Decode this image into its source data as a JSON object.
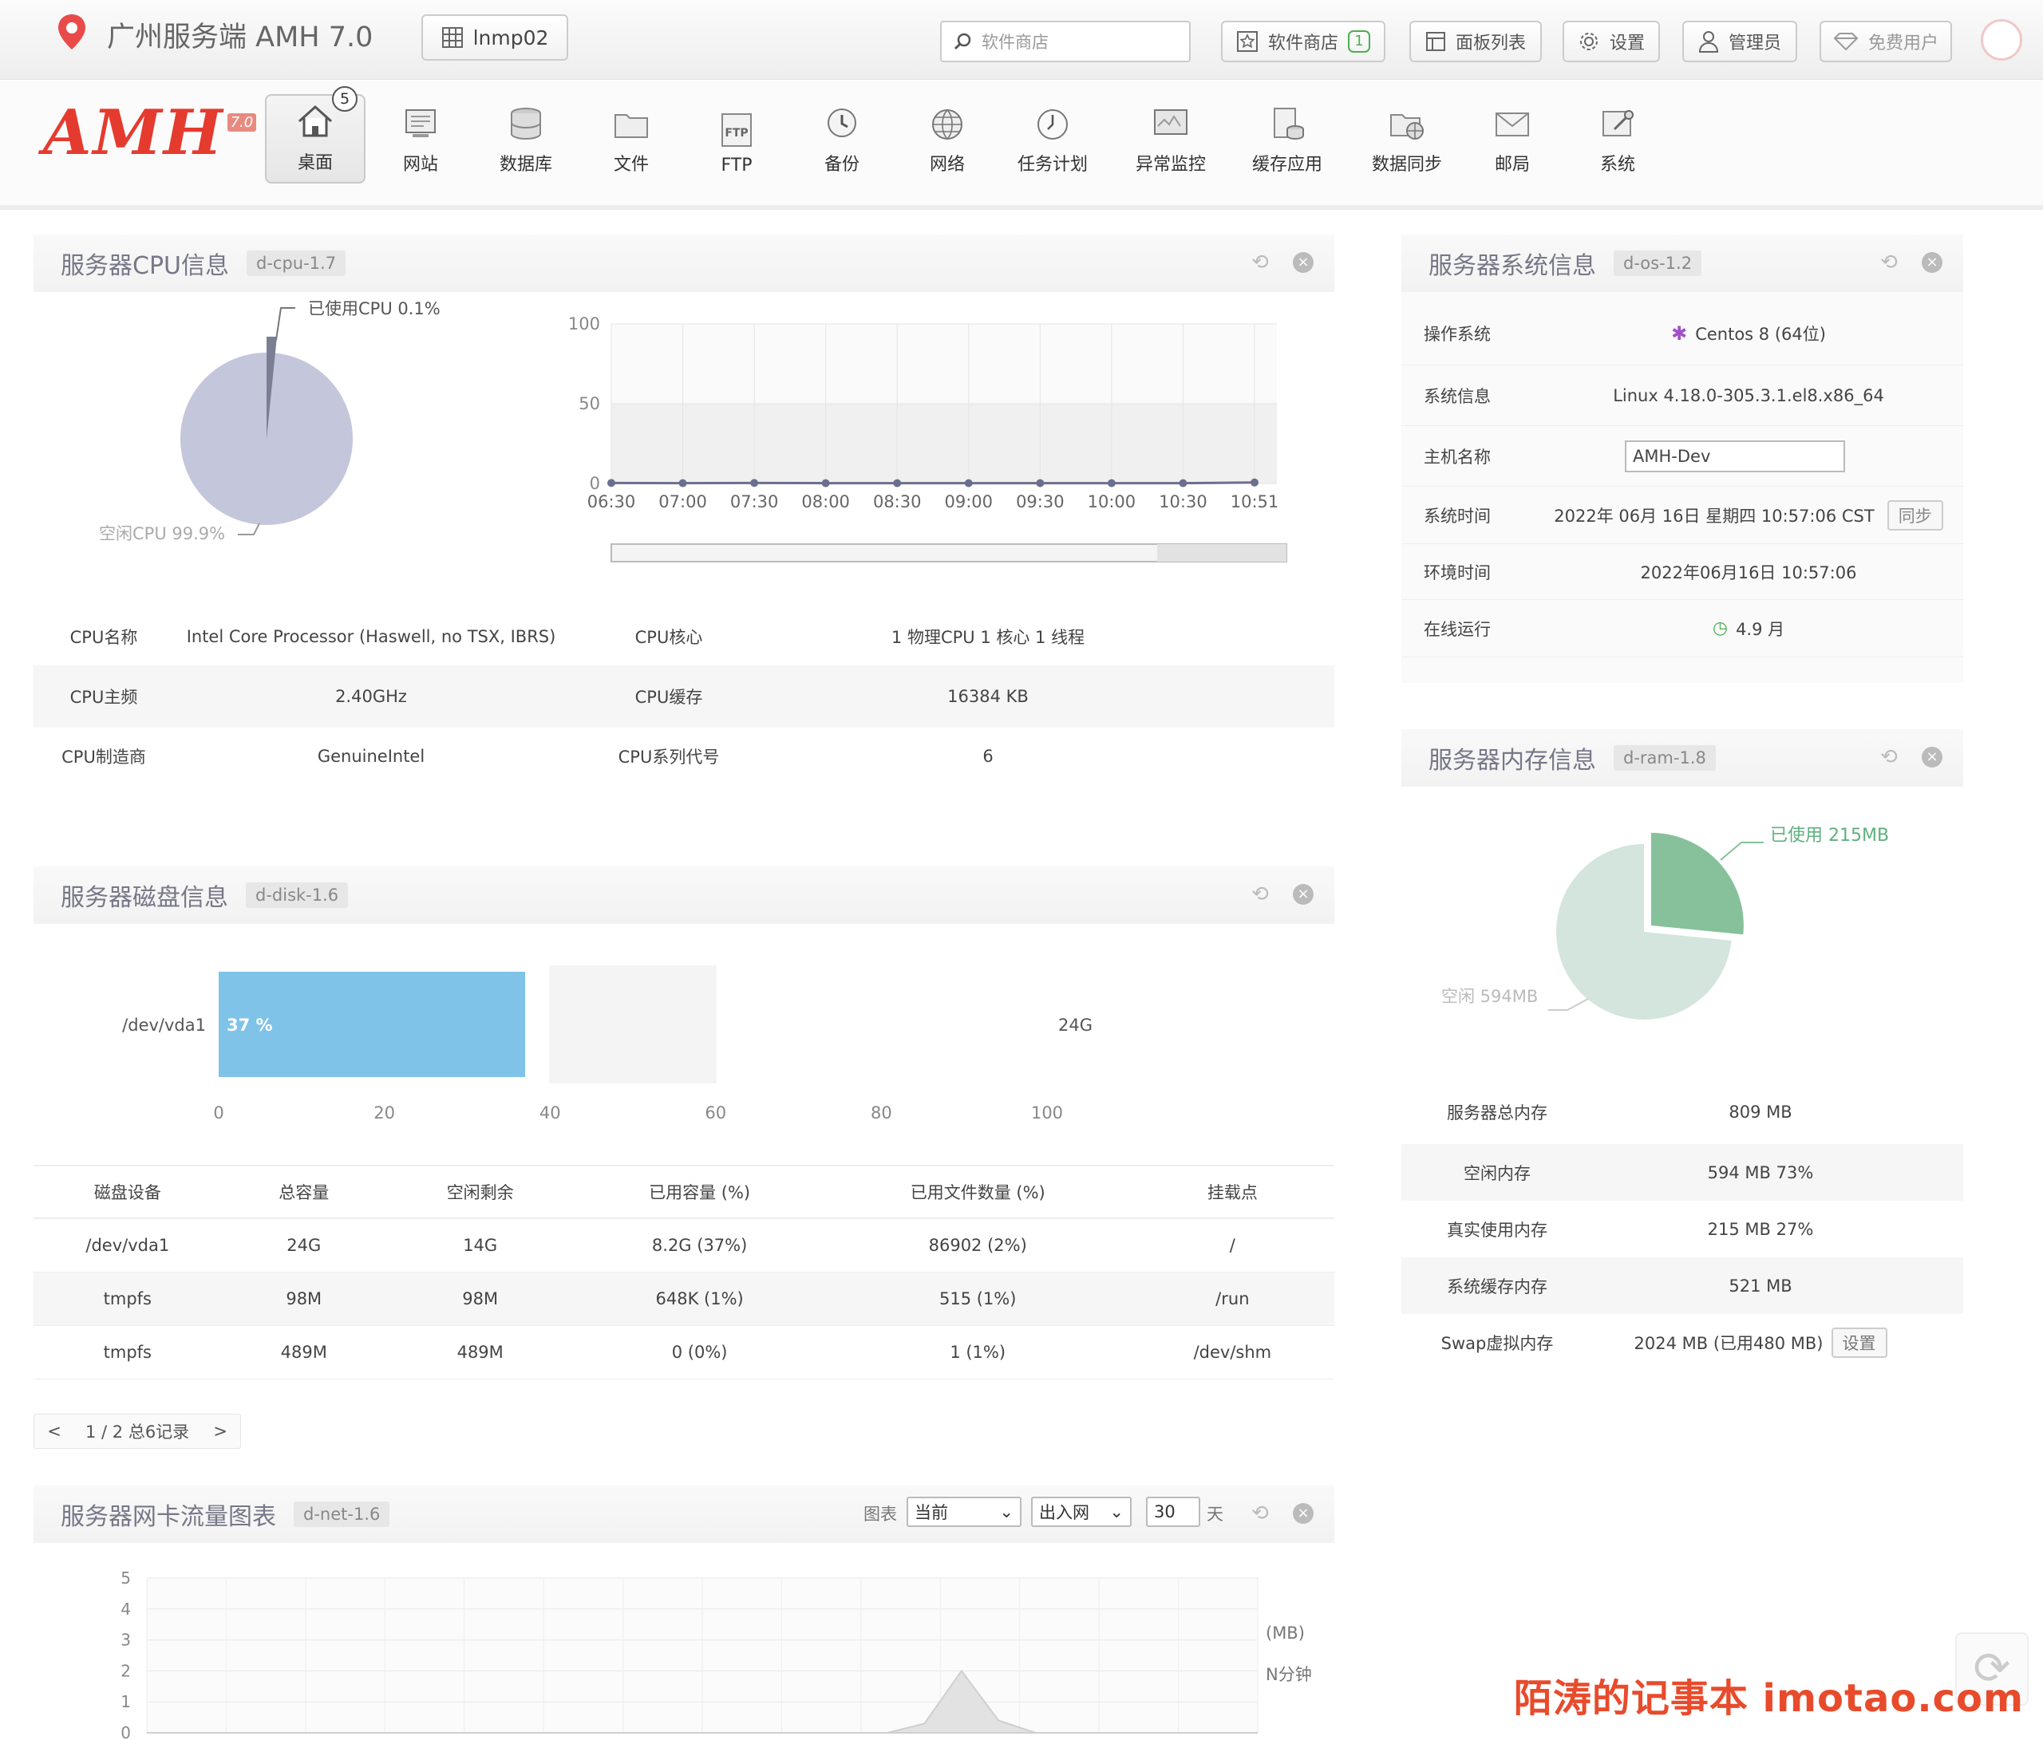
{
  "header": {
    "site_title": "广州服务端 AMH 7.0",
    "server_button": "lnmp02",
    "search_placeholder": "软件商店",
    "store_button": "软件商店",
    "store_badge": "1",
    "panel_list_button": "面板列表",
    "settings_button": "设置",
    "admin_button": "管理员",
    "free_user_button": "免费用户"
  },
  "nav": {
    "logo_text": "AMH",
    "logo_version": "7.0",
    "desktop_badge": "5",
    "items": [
      {
        "label": "桌面",
        "icon": "home-icon"
      },
      {
        "label": "网站",
        "icon": "website-icon"
      },
      {
        "label": "数据库",
        "icon": "database-icon"
      },
      {
        "label": "文件",
        "icon": "folder-icon"
      },
      {
        "label": "FTP",
        "icon": "ftp-icon"
      },
      {
        "label": "备份",
        "icon": "backup-icon"
      },
      {
        "label": "网络",
        "icon": "globe-icon"
      },
      {
        "label": "任务计划",
        "icon": "clock-icon"
      },
      {
        "label": "异常监控",
        "icon": "monitor-icon"
      },
      {
        "label": "缓存应用",
        "icon": "cache-icon"
      },
      {
        "label": "数据同步",
        "icon": "sync-icon"
      },
      {
        "label": "邮局",
        "icon": "mail-icon"
      },
      {
        "label": "系统",
        "icon": "system-icon"
      }
    ]
  },
  "cpu": {
    "title": "服务器CPU信息",
    "tag": "d-cpu-1.7",
    "pie_used_label": "已使用CPU 0.1%",
    "pie_idle_label": "空闲CPU 99.9%",
    "rows": [
      {
        "k1": "CPU名称",
        "v1": "Intel Core Processor (Haswell, no TSX, IBRS)",
        "k2": "CPU核心",
        "v2": "1 物理CPU  1 核心  1 线程"
      },
      {
        "k1": "CPU主频",
        "v1": "2.40GHz",
        "k2": "CPU缓存",
        "v2": "16384 KB"
      },
      {
        "k1": "CPU制造商",
        "v1": "GenuineIntel",
        "k2": "CPU系列代号",
        "v2": "6"
      }
    ]
  },
  "os": {
    "title": "服务器系统信息",
    "tag": "d-os-1.2",
    "rows": [
      {
        "k": "操作系统",
        "v": "Centos 8 (64位)"
      },
      {
        "k": "系统信息",
        "v": "Linux 4.18.0-305.3.1.el8.x86_64"
      },
      {
        "k": "主机名称",
        "v": "AMH-Dev"
      },
      {
        "k": "系统时间",
        "v": "2022年 06月 16日 星期四 10:57:06 CST",
        "btn": "同步"
      },
      {
        "k": "环境时间",
        "v": "2022年06月16日 10:57:06"
      },
      {
        "k": "在线运行",
        "v": "4.9 月"
      }
    ]
  },
  "ram": {
    "title": "服务器内存信息",
    "tag": "d-ram-1.8",
    "used_label": "已使用 215MB",
    "idle_label": "空闲 594MB",
    "rows": [
      {
        "k": "服务器总内存",
        "v": "809 MB"
      },
      {
        "k": "空闲内存",
        "v": "594 MB  73%"
      },
      {
        "k": "真实使用内存",
        "v": "215 MB  27%"
      },
      {
        "k": "系统缓存内存",
        "v": "521 MB"
      },
      {
        "k": "Swap虚拟内存",
        "v": "2024 MB (已用480 MB)",
        "btn": "设置"
      }
    ]
  },
  "disk": {
    "title": "服务器磁盘信息",
    "tag": "d-disk-1.6",
    "bar_device": "/dev/vda1",
    "bar_percent_label": "37 %",
    "bar_total": "24G",
    "headers": [
      "磁盘设备",
      "总容量",
      "空闲剩余",
      "已用容量 (%)",
      "已用文件数量 (%)",
      "挂载点"
    ],
    "rows": [
      [
        "/dev/vda1",
        "24G",
        "14G",
        "8.2G (37%)",
        "86902 (2%)",
        "/"
      ],
      [
        "tmpfs",
        "98M",
        "98M",
        "648K (1%)",
        "515 (1%)",
        "/run"
      ],
      [
        "tmpfs",
        "489M",
        "489M",
        "0 (0%)",
        "1 (1%)",
        "/dev/shm"
      ]
    ],
    "pager": {
      "prev": "<",
      "info": "1 / 2 总6记录",
      "next": ">"
    }
  },
  "net": {
    "title": "服务器网卡流量图表",
    "tag": "d-net-1.6",
    "chart_label": "图表",
    "select_time": "当前",
    "select_dir": "出入网",
    "days_value": "30",
    "days_unit": "天",
    "unit_label": "(MB)",
    "interval_label": "N分钟"
  },
  "watermark": "陌涛的记事本  imotao.com",
  "chart_data": [
    {
      "type": "pie",
      "title": "",
      "slices": [
        {
          "label": "已使用CPU",
          "value": 0.1
        },
        {
          "label": "空闲CPU",
          "value": 99.9
        }
      ]
    },
    {
      "type": "line",
      "x": [
        "06:30",
        "07:00",
        "07:30",
        "08:00",
        "08:30",
        "09:00",
        "09:30",
        "10:00",
        "10:30",
        "10:51"
      ],
      "series": [
        {
          "values": [
            0.3,
            0.2,
            0.3,
            0.2,
            0.2,
            0.2,
            0.2,
            0.2,
            0.2,
            0.6
          ]
        }
      ],
      "ylim": [
        0,
        100
      ],
      "yticks": [
        0,
        50,
        100
      ],
      "grid": true
    },
    {
      "type": "bar",
      "orientation": "horizontal",
      "categories": [
        "/dev/vda1"
      ],
      "values": [
        37
      ],
      "xlim": [
        0,
        100
      ],
      "xticks": [
        0,
        20,
        40,
        60,
        80,
        100
      ]
    },
    {
      "type": "pie",
      "slices": [
        {
          "label": "已使用",
          "value": 215
        },
        {
          "label": "空闲",
          "value": 594
        }
      ]
    },
    {
      "type": "area",
      "ylim": [
        0,
        5
      ],
      "yticks": [
        0,
        1,
        2,
        3,
        4,
        5
      ],
      "ylabel": "(MB)",
      "xlabel": "N分钟",
      "series": [
        {
          "values": [
            0,
            0,
            0,
            0,
            0,
            0,
            0,
            0,
            0,
            0,
            0,
            0,
            0,
            0,
            0,
            0,
            0,
            0,
            0,
            0,
            0,
            0.3,
            2.0,
            0.4,
            0,
            0,
            0,
            0,
            0,
            0,
            0
          ]
        }
      ]
    }
  ]
}
